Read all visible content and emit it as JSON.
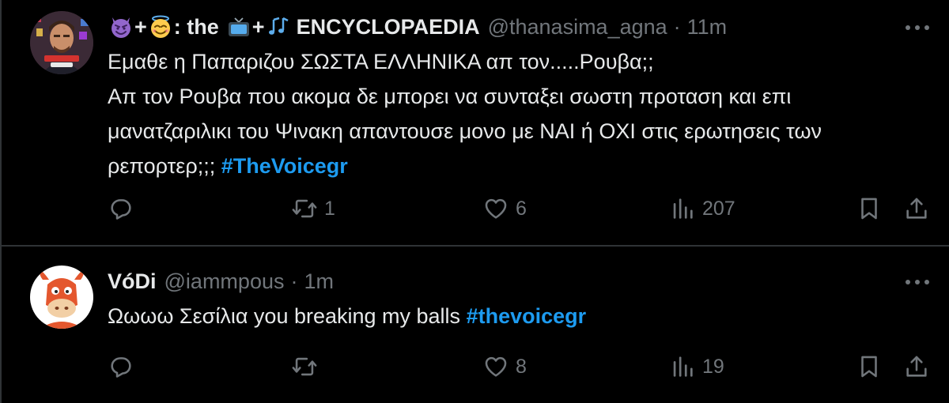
{
  "colors": {
    "background": "#000000",
    "text": "#e7e9ea",
    "muted": "#71767b",
    "link": "#1d9bf0",
    "divider": "#2f3336"
  },
  "tweets": [
    {
      "display_name": {
        "emoji_1": "smiling-devil-emoji",
        "plus_1": "+",
        "emoji_2": "smiling-face-with-halo-emoji",
        "colon_the": ": the",
        "emoji_3": "television-emoji",
        "plus_2": "+",
        "emoji_4": "musical-notes-emoji",
        "word": "ENCYCLOPAEDIA"
      },
      "handle": "@thanasima_agna",
      "dot": "·",
      "time": "11m",
      "text_lines": [
        "Εμαθε η Παπαριζου ΣΩΣΤΑ ΕΛΛΗΝΙΚΑ απ τον.....Ρουβα;;",
        "Απ τον Ρουβα που ακομα δε μπορει να συνταξει σωστη προταση και επι",
        "μανατζαριλικι του Ψινακη απαντουσε μονο με ΝΑΙ ή ΟΧΙ στις ερωτησεις των",
        "ρεπορτερ;;; "
      ],
      "hashtag": "#TheVoicegr",
      "actions": {
        "reply_count": "",
        "repost_count": "1",
        "like_count": "6",
        "views_count": "207"
      }
    },
    {
      "display_name": "VóDi",
      "handle": "@iammpous",
      "dot": "·",
      "time": "1m",
      "text": "Ωωωω Σεσίλια you breaking my balls ",
      "hashtag": "#thevoicegr",
      "actions": {
        "reply_count": "",
        "repost_count": "",
        "like_count": "8",
        "views_count": "19"
      }
    }
  ]
}
